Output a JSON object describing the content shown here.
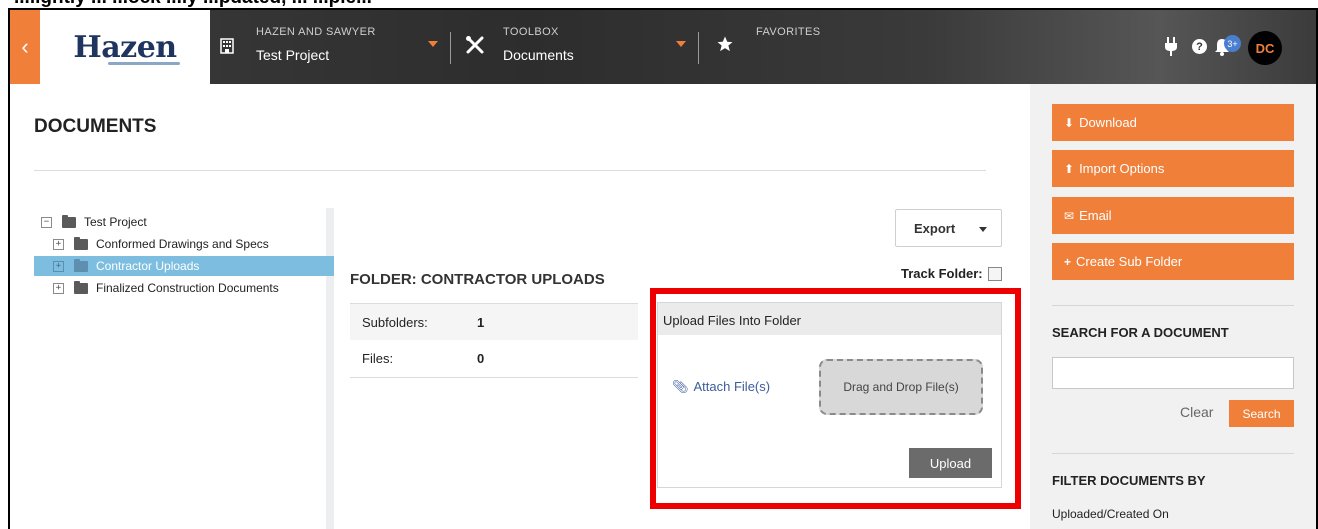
{
  "caption": "...lightly ... ...ock ...ly ...pdated, ... ...ple...",
  "header": {
    "back_icon": "chevron-left-icon",
    "logo": "Hazen",
    "company_label": "HAZEN AND SAWYER",
    "project_name": "Test Project",
    "toolbox_label": "TOOLBOX",
    "toolbox_value": "Documents",
    "favorites_label": "FAVORITES",
    "notification_count": "3+",
    "avatar_initials": "DC",
    "accent": "#f07f39"
  },
  "page": {
    "title": "DOCUMENTS"
  },
  "tree": {
    "root": "Test Project",
    "items": [
      {
        "label": "Conformed Drawings and Specs",
        "selected": false
      },
      {
        "label": "Contractor Uploads",
        "selected": true
      },
      {
        "label": "Finalized Construction Documents",
        "selected": false
      }
    ]
  },
  "folder": {
    "heading": "FOLDER: CONTRACTOR UPLOADS",
    "export_label": "Export",
    "track_label": "Track Folder:",
    "rows": [
      {
        "label": "Subfolders:",
        "value": "1"
      },
      {
        "label": "Files:",
        "value": "0"
      }
    ]
  },
  "upload": {
    "title": "Upload Files Into Folder",
    "attach_label": "Attach File(s)",
    "drop_label": "Drag and Drop File(s)",
    "upload_button": "Upload"
  },
  "sidebar": {
    "actions": [
      {
        "label": "Download",
        "icon": "download-icon"
      },
      {
        "label": "Import Options",
        "icon": "upload-icon"
      },
      {
        "label": "Email",
        "icon": "envelope-icon"
      },
      {
        "label": "Create Sub Folder",
        "icon": "plus-icon"
      }
    ],
    "search_heading": "SEARCH FOR A DOCUMENT",
    "clear_label": "Clear",
    "search_button": "Search",
    "filter_heading": "FILTER DOCUMENTS BY",
    "filter_sub": "Uploaded/Created On"
  }
}
